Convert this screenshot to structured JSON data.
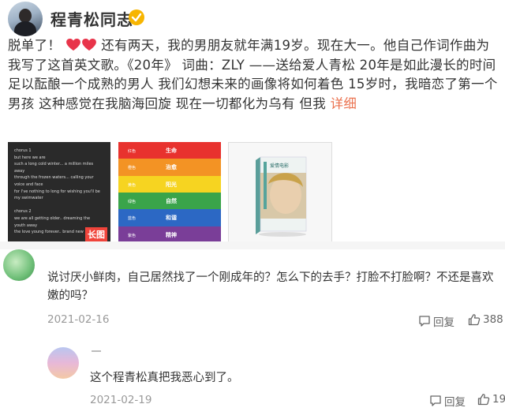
{
  "post": {
    "author": "程青松同志",
    "verified_icon": "verified-badge-icon",
    "text_lead": "脱单了！",
    "text_rest": "还有两天，我的男朋友就年满19岁。现在大一。他自己作词作曲为我写了这首英文歌。《20年》 词曲：ZLY ——送给爱人青松 20年是如此漫长的时间 足以酝酿一个成熟的男人 我们幻想未来的画像将如何着色 15岁时，我暗恋了第一个男孩 这种感觉在我脑海回旋 现在一切都化为乌有 但我",
    "more_link": "详细",
    "images": {
      "lyrics": {
        "lines": [
          "chorus 1",
          "but here we are",
          "such a long cold winter... a million miles",
          "away",
          "through the frozen waters... calling your",
          "voice and face",
          "for I've nothing to long for wishing you'll be",
          "my swimwater",
          "",
          "chorus 2",
          "we are all getting older.. dreaming the",
          "youth away",
          "the love young forever.. brand new"
        ],
        "badge": "长图"
      },
      "rainbow": {
        "stripes": [
          {
            "label": "红色",
            "text": "生命",
            "color": "#e8322e"
          },
          {
            "label": "橙色",
            "text": "治愈",
            "color": "#f39324"
          },
          {
            "label": "黄色",
            "text": "阳光",
            "color": "#f6d421"
          },
          {
            "label": "绿色",
            "text": "自然",
            "color": "#3aa44a"
          },
          {
            "label": "蓝色",
            "text": "和谐",
            "color": "#2c68c4"
          },
          {
            "label": "紫色",
            "text": "精神",
            "color": "#7a3e98"
          }
        ]
      },
      "book": {
        "title": "爱情电影"
      }
    }
  },
  "comments": [
    {
      "text": "说讨厌小鲜肉，自己居然找了一个刚成年的？怎么下的去手？打脸不打脸啊？不还是喜欢嫩的吗？",
      "date": "2021-02-16",
      "reply_label": "回复",
      "like_count": "388"
    }
  ],
  "reply": {
    "text": "这个程青松真把我恶心到了。",
    "date": "2021-02-19",
    "reply_label": "回复",
    "like_count": "19"
  },
  "colors": {
    "link": "#eb7350",
    "heart": "#e8344a",
    "verified": "#f7b500"
  }
}
